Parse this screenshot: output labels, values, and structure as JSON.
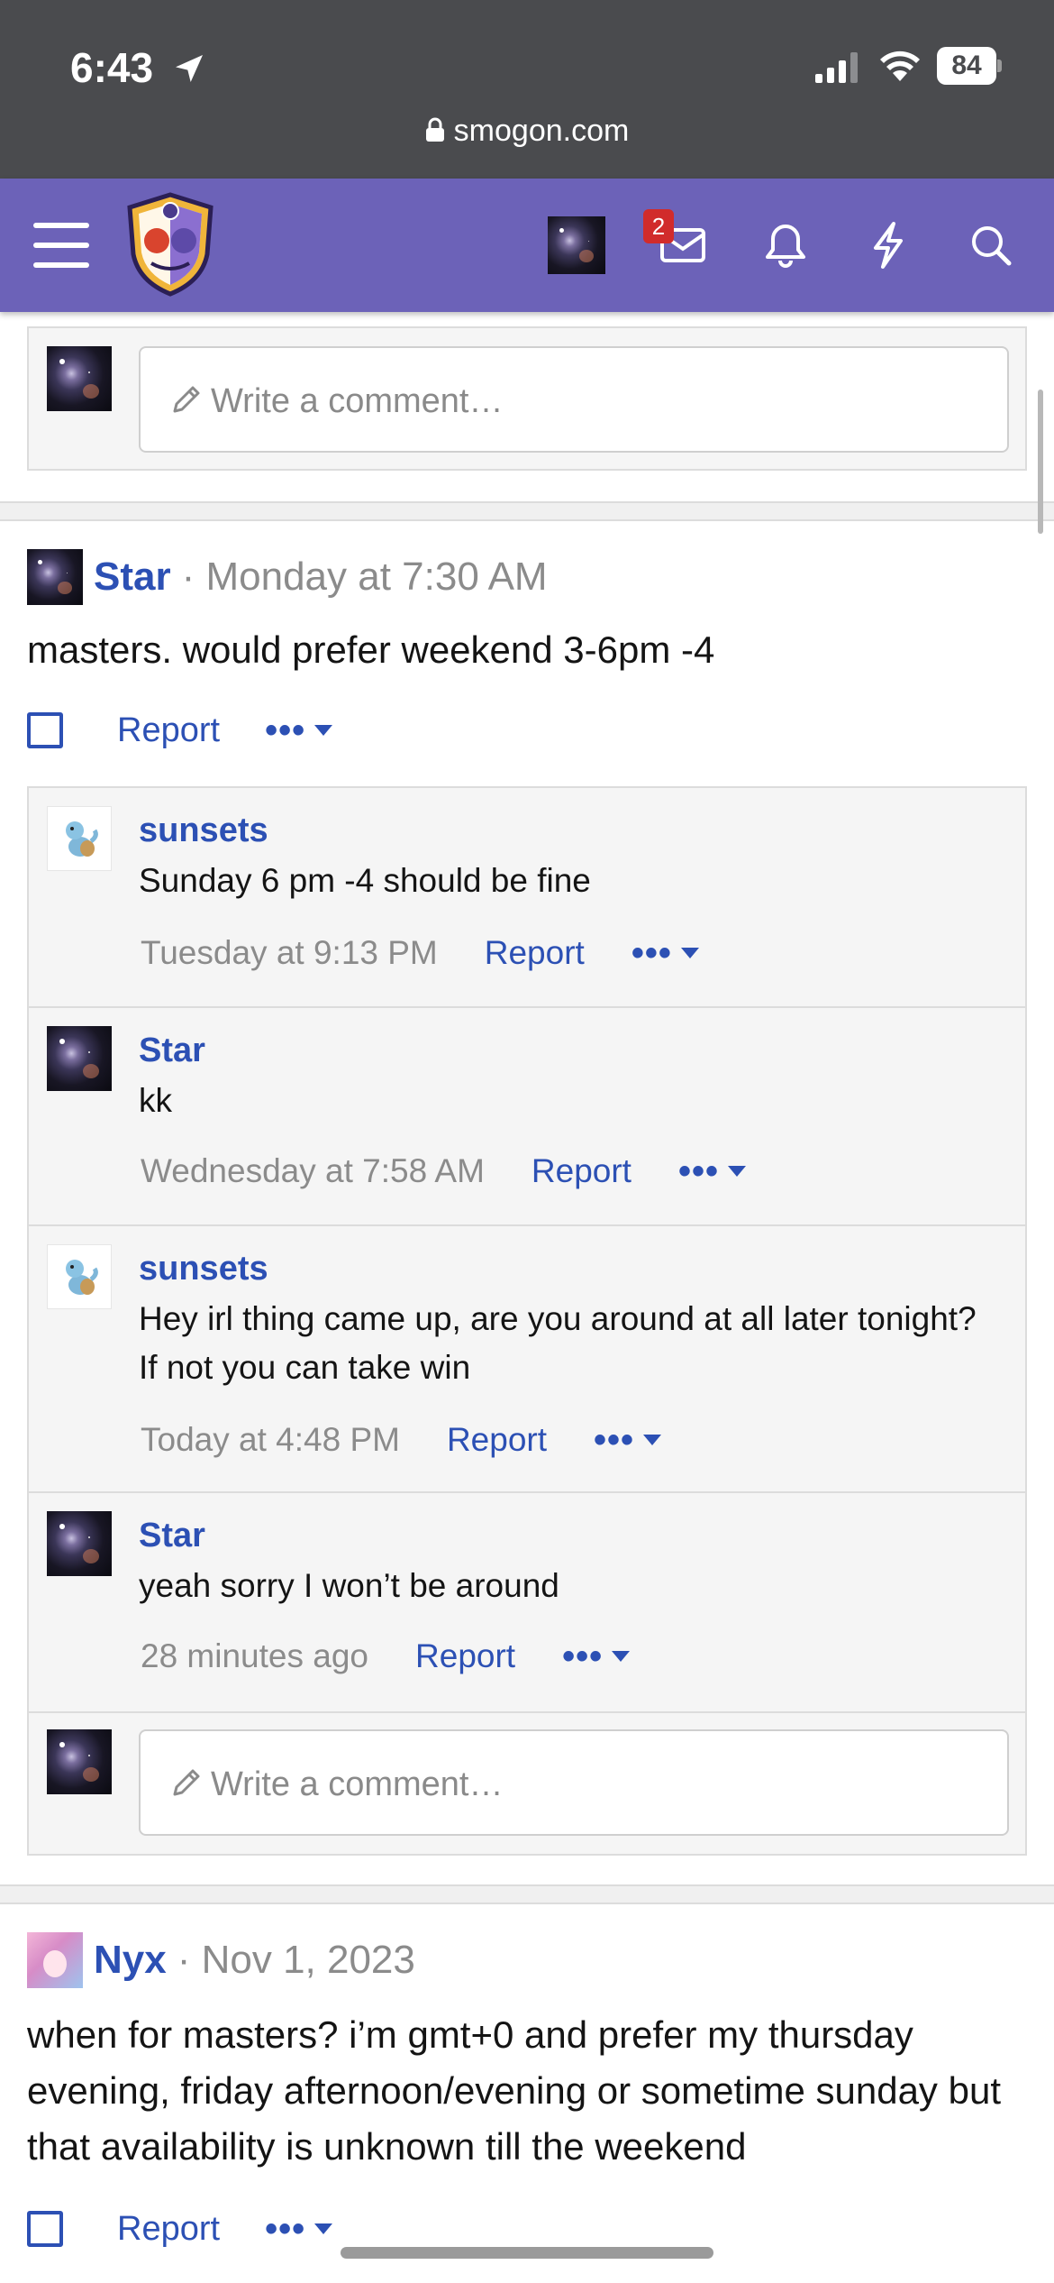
{
  "status_bar": {
    "time": "6:43",
    "battery": "84",
    "url": "smogon.com"
  },
  "nav": {
    "inbox_badge": "2",
    "icons": [
      "menu-icon",
      "smogon-logo",
      "inbox-icon",
      "bell-icon",
      "bolt-icon",
      "search-icon"
    ]
  },
  "top_comment_box": {
    "placeholder": "Write a comment…"
  },
  "post1": {
    "username": "Star",
    "date": "· Monday at 7:30 AM",
    "body": "masters. would prefer weekend 3-6pm -4",
    "report_label": "Report",
    "more_label": "•••"
  },
  "replies": [
    {
      "username": "sunsets",
      "text": "Sunday 6 pm -4 should be fine",
      "date": "Tuesday at 9:13 PM",
      "report_label": "Report",
      "more_label": "•••"
    },
    {
      "username": "Star",
      "text": "kk",
      "date": "Wednesday at 7:58 AM",
      "report_label": "Report",
      "more_label": "•••"
    },
    {
      "username": "sunsets",
      "text": "Hey irl thing came up, are you around at all later tonight? If not you can take win",
      "date": "Today at 4:48 PM",
      "report_label": "Report",
      "more_label": "•••"
    },
    {
      "username": "Star",
      "text": "yeah sorry I won’t be around",
      "date": "28 minutes ago",
      "report_label": "Report",
      "more_label": "•••"
    }
  ],
  "reply_comment_box": {
    "placeholder": "Write a comment…"
  },
  "post2": {
    "username": "Nyx",
    "date": "· Nov 1, 2023",
    "body": "when for masters? i’m gmt+0 and prefer my thursday evening, friday afternoon/evening or sometime sunday but that availability is unknown till the weekend",
    "report_label": "Report",
    "more_label": "•••"
  },
  "colors": {
    "nav_purple": "#6c62b8",
    "link_blue": "#2c50b4",
    "status_bar": "#4a4b4e",
    "badge_red": "#d12b2b"
  }
}
